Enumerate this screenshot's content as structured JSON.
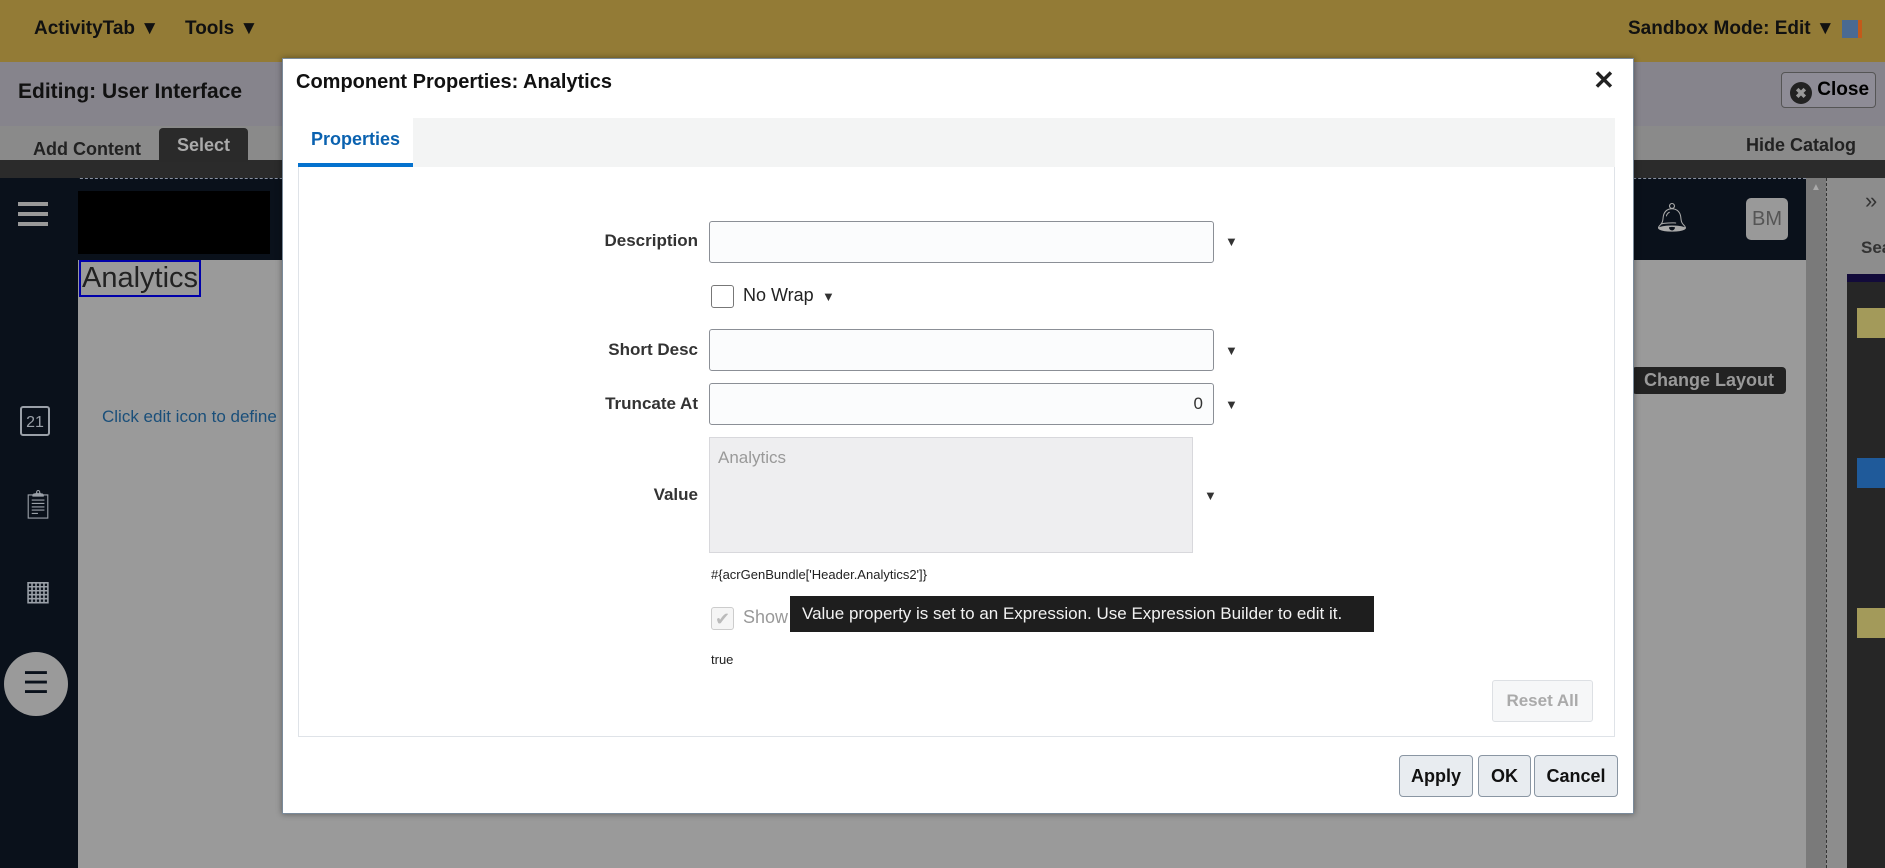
{
  "topbar": {
    "activity_tab": "ActivityTab",
    "tools": "Tools",
    "sandbox_mode": "Sandbox Mode: Edit"
  },
  "editbar": {
    "title": "Editing: User Interface",
    "close": "Close"
  },
  "tabs": {
    "add_content": "Add Content",
    "select": "Select",
    "hide_catalog": "Hide Catalog"
  },
  "page": {
    "heading": "Analytics",
    "hint": "Click edit icon to define",
    "change_layout": "Change Layout",
    "avatar": "BM",
    "calendar_day": "21",
    "catalog_search": "Sea"
  },
  "dialog": {
    "title": "Component Properties: Analytics",
    "tab": "Properties",
    "fields": {
      "description_label": "Description",
      "description_value": "",
      "nowrap_label": "No Wrap",
      "short_desc_label": "Short Desc",
      "short_desc_value": "",
      "truncate_label": "Truncate At",
      "truncate_value": "0",
      "value_label": "Value",
      "value_value": "Analytics",
      "value_expression": "#{acrGenBundle['Header.Analytics2']}",
      "show_label": "Show",
      "show_value": "true"
    },
    "tooltip": "Value property is set to an Expression. Use Expression Builder to edit it.",
    "reset_all": "Reset All",
    "apply": "Apply",
    "ok": "OK",
    "cancel": "Cancel"
  }
}
